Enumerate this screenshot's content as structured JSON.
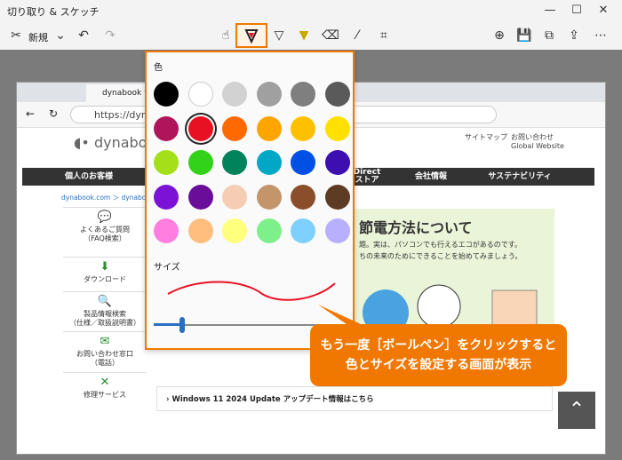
{
  "window": {
    "title": "切り取り & スケッチ",
    "minimize": "—",
    "maximize": "☐",
    "close": "✕"
  },
  "toolbar": {
    "new_label": "新規"
  },
  "browser": {
    "tab_title": "dynabook サポー",
    "url": "https://dynabook"
  },
  "site": {
    "logo": "dynabook",
    "header_links": [
      "サイトマップ",
      "お問い合わせ",
      "Global Website"
    ],
    "nav": [
      "個人のお客様",
      "Direct\nストア",
      "会社情報",
      "サステナビリティ"
    ],
    "breadcrumb": "dynabook.com ＞ dynabook サポ",
    "sidebar": [
      {
        "label": "よくあるご質問\n（FAQ検索）"
      },
      {
        "label": "ダウンロード"
      },
      {
        "label": "製品情報検索\n（仕様／取扱説明書）"
      },
      {
        "label": "お問い合わせ窓口\n（電話）"
      },
      {
        "label": "修理サービス"
      }
    ],
    "banner_title": "節電方法について",
    "banner_body": "題。実は、パソコンでも行えるエコがあるのです。\nちの未来のためにできることを始めてみましょう。",
    "update_text": "Windows 11 2024 Update アップデート情報はこちら"
  },
  "panel": {
    "color_label": "色",
    "size_label": "サイズ",
    "swatches": [
      [
        "#000000",
        "#ffffff",
        "#d2d2d2",
        "#a0a0a0",
        "#7f7f7f",
        "#5a5a5a"
      ],
      [
        "#b0155c",
        "#e81123",
        "#ff6a00",
        "#ffa500",
        "#ffc000",
        "#ffe000"
      ],
      [
        "#a4e01a",
        "#32d11a",
        "#00825a",
        "#00a8c6",
        "#0050e6",
        "#3d0fb0"
      ],
      [
        "#7b12d6",
        "#6a0e9a",
        "#f5cdb4",
        "#c4956a",
        "#8a4f2a",
        "#5e3b23"
      ],
      [
        "#ff7ee0",
        "#ffbe7e",
        "#ffff7e",
        "#7ef08a",
        "#7ed0ff",
        "#b8b0ff"
      ]
    ],
    "selected": "#e81123",
    "size_value": 0.15
  },
  "callout": {
    "line1": "もう一度［ボールペン］をクリックすると",
    "line2": "色とサイズを設定する画面が表示"
  }
}
